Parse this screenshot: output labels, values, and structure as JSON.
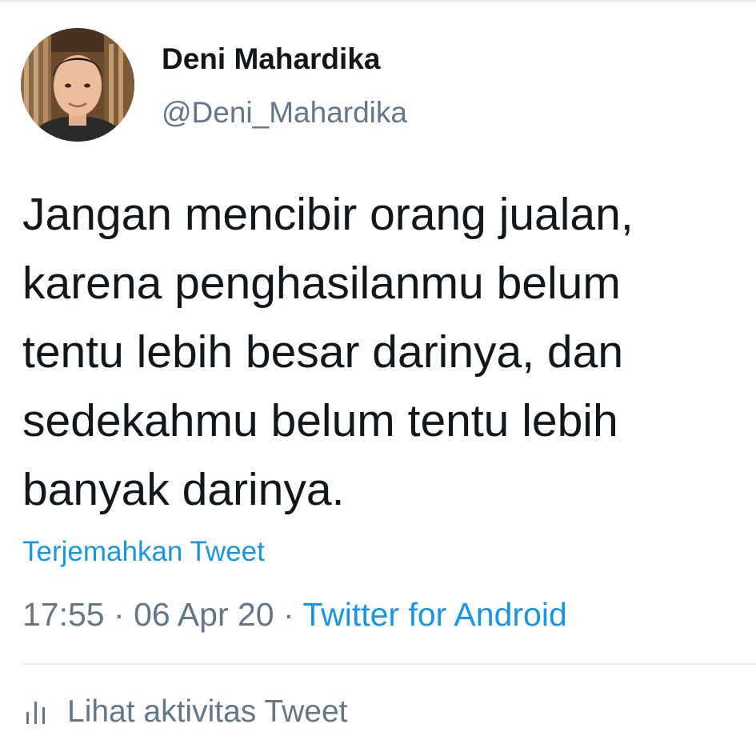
{
  "author": {
    "display_name": "Deni Mahardika",
    "handle": "@Deni_Mahardika"
  },
  "tweet": {
    "text_lines": [
      "Jangan mencibir orang jualan,",
      "karena penghasilanmu belum",
      "tentu lebih besar darinya, dan",
      "sedekahmu belum tentu lebih",
      "banyak darinya."
    ],
    "translate_label": "Terjemahkan Tweet",
    "time": "17:55",
    "separator": "·",
    "date": "06 Apr 20",
    "source": "Twitter for Android"
  },
  "activity": {
    "icon": "bar-chart-icon",
    "label": "Lihat aktivitas Tweet"
  },
  "colors": {
    "text_primary": "#14171a",
    "text_secondary": "#657786",
    "link": "#1b95e0",
    "divider": "#e6ecf0"
  }
}
